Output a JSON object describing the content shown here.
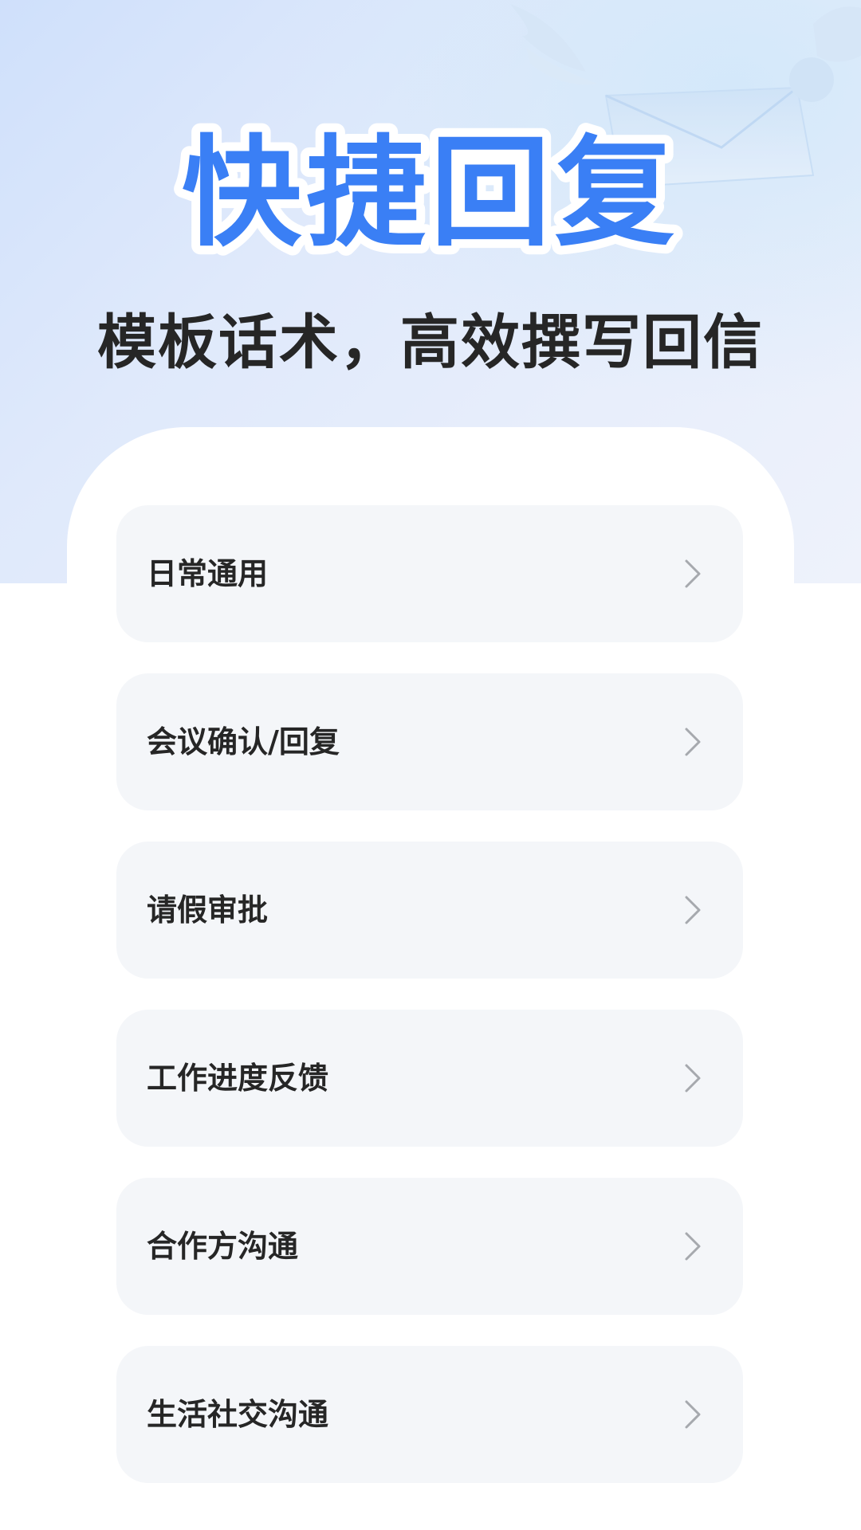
{
  "header": {
    "title": "快捷回复",
    "subtitle": "模板话术，高效撰写回信",
    "title_color": "#3a7ff5",
    "decoration_icon": "winged-envelope-icon"
  },
  "categories": [
    {
      "label": "日常通用"
    },
    {
      "label": "会议确认/回复"
    },
    {
      "label": "请假审批"
    },
    {
      "label": "工作进度反馈"
    },
    {
      "label": "合作方沟通"
    },
    {
      "label": "生活社交沟通"
    }
  ],
  "chevron_icon": "chevron-right-icon"
}
